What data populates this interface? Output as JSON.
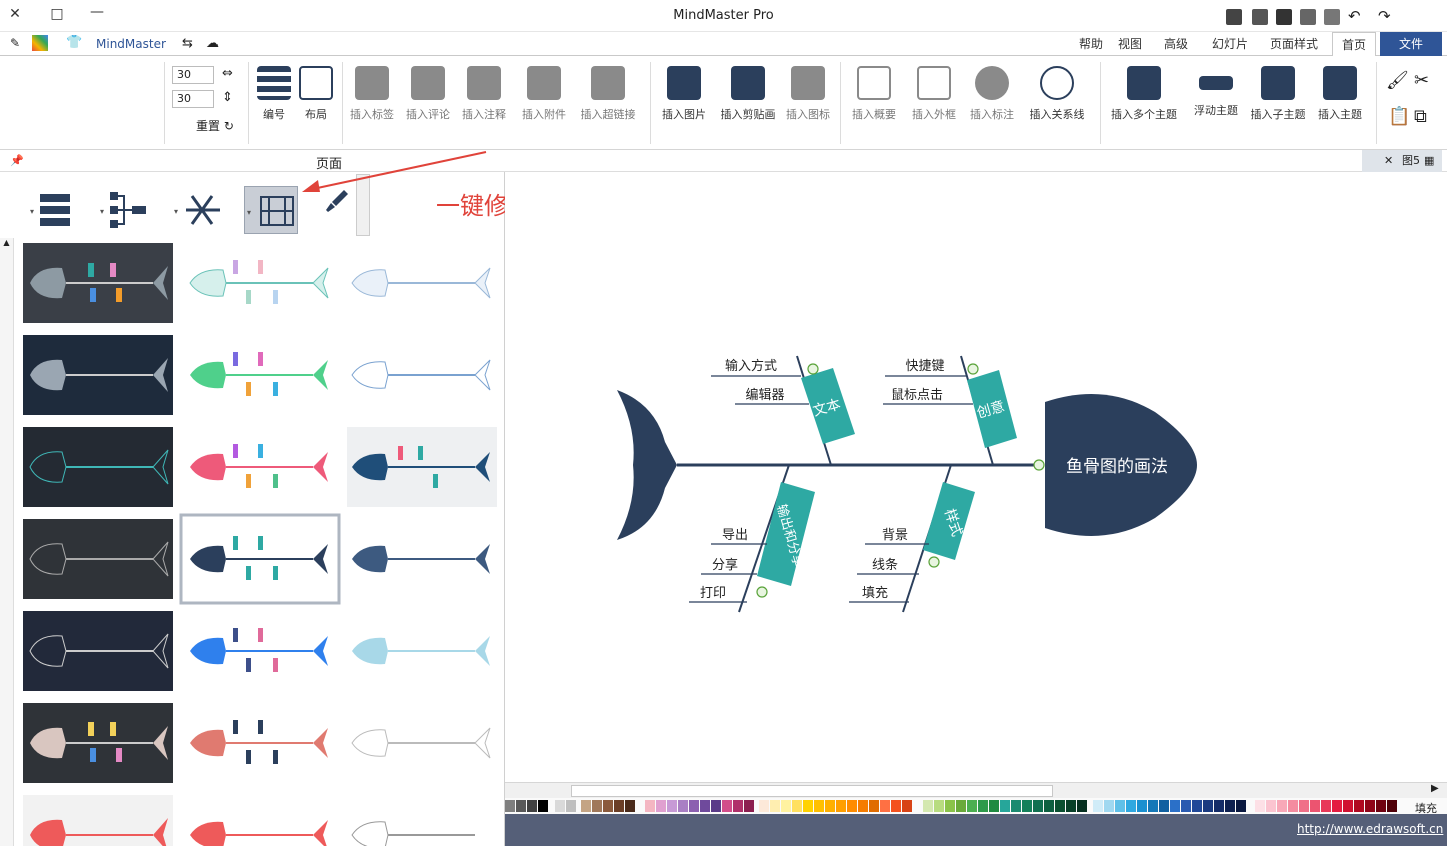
{
  "app": {
    "title": "MindMaster Pro",
    "brand": "MindMaster",
    "accent": "#2f5597"
  },
  "tabs": [
    {
      "label": "文件"
    },
    {
      "label": "首页"
    },
    {
      "label": "页面样式"
    },
    {
      "label": "幻灯片"
    },
    {
      "label": "高级"
    },
    {
      "label": "视图"
    },
    {
      "label": "帮助"
    }
  ],
  "ribbon": {
    "buttons": [
      {
        "label": "插入主题"
      },
      {
        "label": "插入子主题"
      },
      {
        "label": "浮动主题"
      },
      {
        "label": "插入多个主题"
      },
      {
        "label": "插入关系线"
      },
      {
        "label": "插入标注"
      },
      {
        "label": "插入外框"
      },
      {
        "label": "插入概要"
      },
      {
        "label": "插入图标"
      },
      {
        "label": "插入剪贴画"
      },
      {
        "label": "插入图片"
      },
      {
        "label": "插入超链接"
      },
      {
        "label": "插入附件"
      },
      {
        "label": "插入注释"
      },
      {
        "label": "插入评论"
      },
      {
        "label": "插入标签"
      },
      {
        "label": "布局"
      },
      {
        "label": "编号"
      }
    ],
    "spacing_h": "30",
    "spacing_v": "30",
    "reset_label": "重置"
  },
  "page_panel": {
    "title": "页面",
    "doc_tab": "图5"
  },
  "annotation": "一键修改样式",
  "fishbone": {
    "head": "鱼骨图的画法",
    "branches": [
      {
        "label": "创意",
        "items": [
          "快捷键",
          "鼠标点击"
        ]
      },
      {
        "label": "文本",
        "items": [
          "输入方式",
          "编辑器"
        ]
      },
      {
        "label": "样式",
        "items": [
          "背景",
          "线条",
          "填充"
        ]
      },
      {
        "label": "输出和分享",
        "items": [
          "导出",
          "分享",
          "打印"
        ]
      }
    ]
  },
  "palette_label": "填充",
  "status": {
    "url": "http://www.edrawsoft.cn"
  },
  "colors": {
    "fish_dark": "#2b3f5c",
    "branch_teal": "#2ea9a3",
    "status_bg": "#555f78"
  }
}
